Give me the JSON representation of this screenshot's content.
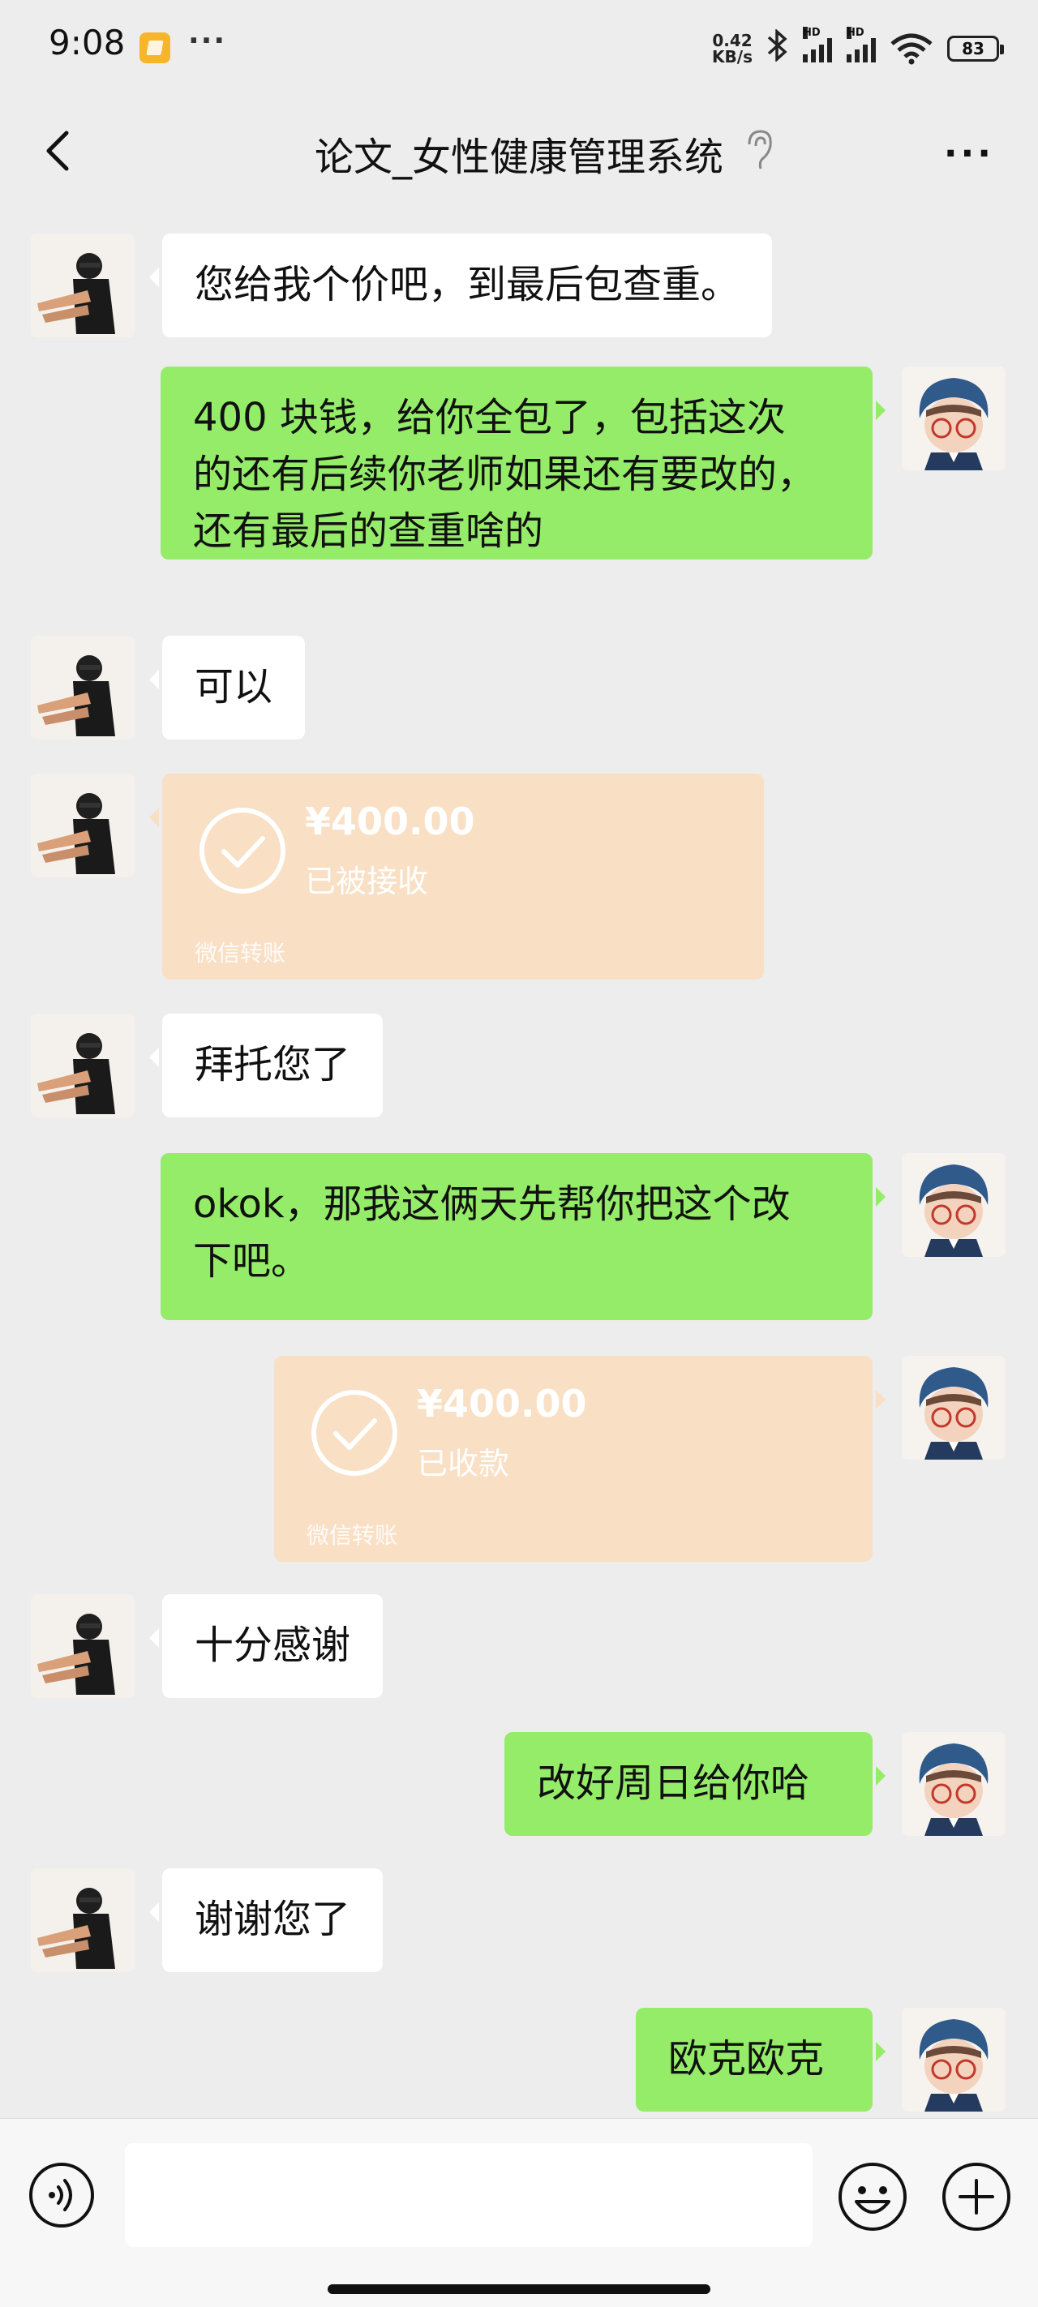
{
  "status_bar": {
    "time": "9:08",
    "notification_more": "···",
    "net_speed_value": "0.42",
    "net_speed_unit": "KB/s",
    "signal_1_label": "HD",
    "signal_2_label": "HD",
    "battery": "83"
  },
  "nav": {
    "title": "论文_女性健康管理系统",
    "more": "···"
  },
  "messages": [
    {
      "side": "left",
      "type": "text",
      "text": "您给我个价吧，到最后包查重。"
    },
    {
      "side": "right",
      "type": "text",
      "lines": [
        "400 块钱，给你全包了，包括这次",
        "的还有后续你老师如果还有要改的，",
        "还有最后的查重啥的"
      ]
    },
    {
      "side": "left",
      "type": "text",
      "text": "可以"
    },
    {
      "side": "left",
      "type": "transfer",
      "amount": "¥400.00",
      "status": "已被接收",
      "footer": "微信转账"
    },
    {
      "side": "left",
      "type": "text",
      "text": "拜托您了"
    },
    {
      "side": "right",
      "type": "text",
      "lines": [
        "okok，那我这俩天先帮你把这个改",
        "下吧。"
      ]
    },
    {
      "side": "right",
      "type": "transfer",
      "amount": "¥400.00",
      "status": "已收款",
      "footer": "微信转账"
    },
    {
      "side": "left",
      "type": "text",
      "text": "十分感谢"
    },
    {
      "side": "right",
      "type": "text",
      "text": "改好周日给你哈"
    },
    {
      "side": "left",
      "type": "text",
      "text": "谢谢您了"
    },
    {
      "side": "right",
      "type": "text",
      "text": "欧克欧克"
    }
  ],
  "input": {
    "placeholder": ""
  },
  "colors": {
    "background": "#ededed",
    "sent_bubble": "#95ec69",
    "received_bubble": "#ffffff",
    "transfer_card": "#f9dfc4"
  }
}
